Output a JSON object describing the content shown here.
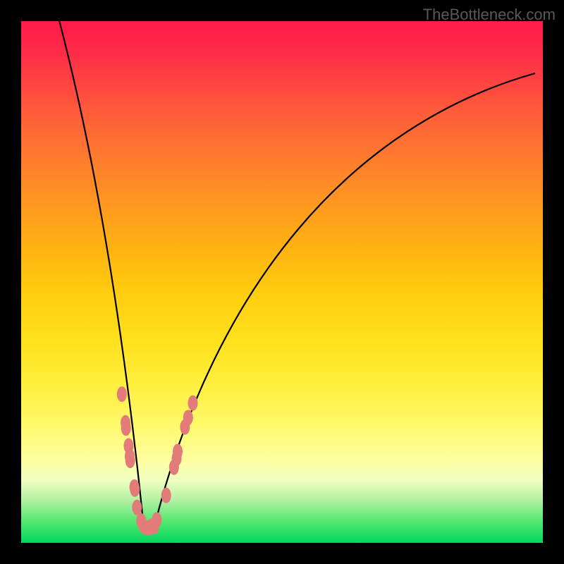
{
  "watermark": "TheBottleneck.com",
  "chart_data": {
    "type": "line",
    "title": "",
    "xlabel": "",
    "ylabel": "",
    "xlim": [
      0,
      1
    ],
    "ylim": [
      0,
      1
    ],
    "curve_left_from": [
      0.068,
      1.02
    ],
    "curve_left_to": [
      0.235,
      0.03
    ],
    "curve_left_ctrl": [
      0.175,
      0.62
    ],
    "curve_right_from": [
      0.255,
      0.03
    ],
    "curve_right_to": [
      0.985,
      0.9
    ],
    "curve_right_ctrl1": [
      0.37,
      0.49
    ],
    "curve_right_ctrl2": [
      0.63,
      0.8
    ],
    "markers_left": [
      {
        "x": 0.193,
        "y": 0.285
      },
      {
        "x": 0.2,
        "y": 0.23
      },
      {
        "x": 0.201,
        "y": 0.22
      },
      {
        "x": 0.206,
        "y": 0.186
      },
      {
        "x": 0.208,
        "y": 0.166
      },
      {
        "x": 0.209,
        "y": 0.158
      },
      {
        "x": 0.217,
        "y": 0.107
      },
      {
        "x": 0.218,
        "y": 0.103
      },
      {
        "x": 0.222,
        "y": 0.068
      },
      {
        "x": 0.23,
        "y": 0.042
      },
      {
        "x": 0.235,
        "y": 0.032
      }
    ],
    "markers_right": [
      {
        "x": 0.25,
        "y": 0.032
      },
      {
        "x": 0.26,
        "y": 0.044
      },
      {
        "x": 0.278,
        "y": 0.091
      },
      {
        "x": 0.293,
        "y": 0.145
      },
      {
        "x": 0.298,
        "y": 0.162
      },
      {
        "x": 0.3,
        "y": 0.175
      },
      {
        "x": 0.314,
        "y": 0.222
      },
      {
        "x": 0.32,
        "y": 0.24
      },
      {
        "x": 0.329,
        "y": 0.268
      }
    ],
    "markers_bottom": [
      {
        "x": 0.238,
        "y": 0.027
      },
      {
        "x": 0.244,
        "y": 0.024
      },
      {
        "x": 0.252,
        "y": 0.026
      }
    ]
  }
}
